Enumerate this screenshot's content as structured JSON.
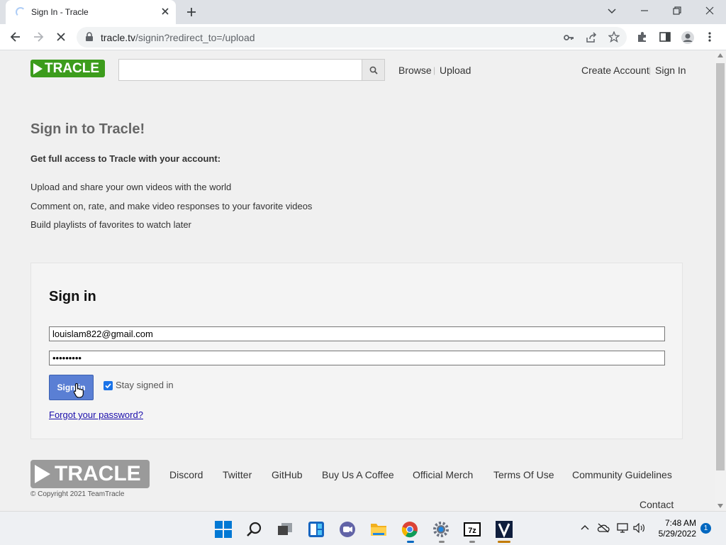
{
  "browser": {
    "tab_title": "Sign In - Tracle",
    "url_host": "tracle.tv",
    "url_path": "/signin?redirect_to=/upload"
  },
  "header": {
    "logo_text": "TRACLE",
    "search_placeholder": "",
    "nav": [
      "Browse",
      "Upload"
    ],
    "account": [
      "Create Account",
      "Sign In"
    ]
  },
  "intro": {
    "title": "Sign in to Tracle!",
    "subtitle": "Get full access to Tracle with your account:",
    "features": [
      "Upload and share your own videos with the world",
      "Comment on, rate, and make video responses to your favorite videos",
      "Build playlists of favorites to watch later"
    ]
  },
  "form": {
    "heading": "Sign in",
    "email_value": "louislam822@gmail.com",
    "password_value": "•••••••••",
    "submit_label": "Sign in",
    "stay_signed_in_label": "Stay signed in",
    "stay_signed_in_checked": true,
    "forgot_label": "Forgot your password?"
  },
  "footer": {
    "logo_text": "TRACLE",
    "links": [
      "Discord",
      "Twitter",
      "GitHub",
      "Buy Us A Coffee",
      "Official Merch",
      "Terms Of Use",
      "Community Guidelines"
    ],
    "contact": "Contact",
    "copyright": "© Copyright 2021 TeamTracle"
  },
  "taskbar": {
    "time": "7:48 AM",
    "date": "5/29/2022",
    "notification_count": "1",
    "icons": [
      "windows-start-icon",
      "search-icon",
      "task-view-icon",
      "widgets-icon",
      "chat-icon",
      "file-explorer-icon",
      "chrome-icon",
      "settings-icon",
      "7zip-icon",
      "vegas-icon"
    ]
  },
  "colors": {
    "logo_green": "#3c9c1c",
    "signin_button": "#5a7fd4",
    "link_blue": "#1a0dab"
  }
}
